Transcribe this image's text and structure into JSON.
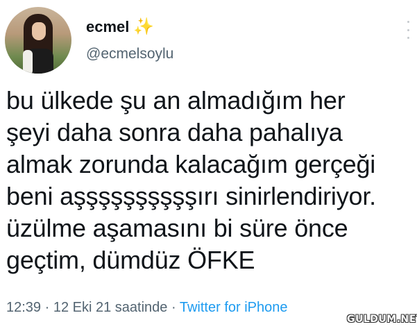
{
  "author": {
    "display_name": "ecmel",
    "emoji": "✨",
    "handle": "@ecmelsoylu"
  },
  "tweet": {
    "text": "bu ülkede şu an almadığım her\nşeyi daha sonra daha pahalıya\nalmak zorunda kalacağım gerçeği\nbeni aşşşşşşşşşşırı sinirlendiriyor.\nüzülme aşamasını bi süre önce\ngeçtim, dümdüz ÖFKE",
    "time": "12:39",
    "separator": "·",
    "date": "12 Eki 21 saatinde",
    "source": "Twitter for iPhone"
  },
  "watermark": "GULDUM.NET",
  "icons": {
    "more": "more-options-icon",
    "sparkle": "sparkles-emoji"
  },
  "colors": {
    "text": "#0f1419",
    "secondary": "#536471",
    "link": "#1d9bf0",
    "sparkle": "#f4b400"
  }
}
